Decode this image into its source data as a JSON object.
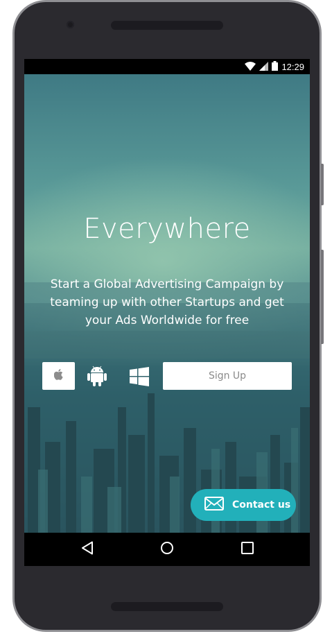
{
  "status_bar": {
    "time": "12:29",
    "icons": [
      "wifi-icon",
      "signal-icon",
      "battery-icon"
    ]
  },
  "hero": {
    "headline": "Everywhere",
    "description": "Start a Global Advertising Campaign by teaming up with other Startups and get your Ads Worldwide for free"
  },
  "platforms": {
    "icons": [
      "apple-icon",
      "android-icon",
      "windows-icon"
    ]
  },
  "signup": {
    "label": "Sign Up"
  },
  "contact": {
    "label": "Contact us",
    "icon": "envelope-icon"
  },
  "nav_bar": {
    "icons": [
      "back-icon",
      "home-icon",
      "recents-icon"
    ]
  },
  "colors": {
    "accent": "#22b0ba",
    "device_body": "#2b2a2f",
    "device_bezel": "#8f8f93"
  }
}
